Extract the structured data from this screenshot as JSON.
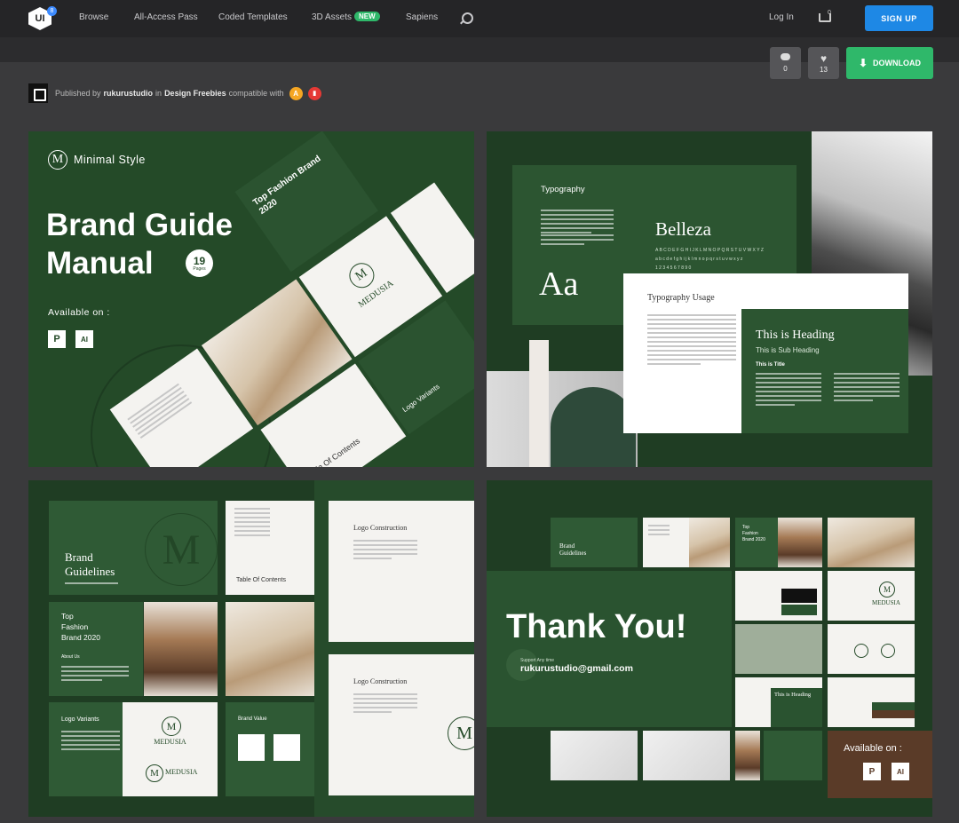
{
  "nav": {
    "logo": "UI",
    "logo_badge": "8",
    "links": [
      "Browse",
      "All-Access Pass",
      "Coded Templates",
      "3D Assets",
      "Sapiens"
    ],
    "new_badge": "NEW",
    "login": "Log In",
    "cart_count": "0",
    "signup": "SIGN UP"
  },
  "stats": {
    "comments": "0",
    "likes": "13",
    "download": "DOWNLOAD"
  },
  "publisher": {
    "prefix": "Published by",
    "author": "rukurustudio",
    "in": "in",
    "category": "Design Freebies",
    "compatible": "compatible with",
    "apps": [
      {
        "letter": "A",
        "color": "#f5a623"
      },
      {
        "letter": "▮",
        "color": "#e53935"
      }
    ]
  },
  "panel1": {
    "brand": "Minimal Style",
    "title_l1": "Brand Guide",
    "title_l2": "Manual",
    "pages_num": "19",
    "pages_label": "Pages",
    "available": "Available on :",
    "app1": "P",
    "app2": "AI",
    "card_top_fashion": "Top Fashion Brand 2020",
    "card_toc": "Table Of Contents",
    "card_logo_variants": "Logo Variants",
    "card_medusia": "MEDUSIA"
  },
  "panel2": {
    "typography": "Typography",
    "belleza": "Belleza",
    "alphabet_upper": "A B C D E F G H I J K L M N O P Q R S T U V W X Y Z",
    "alphabet_lower": "a b c d e f g h i j k l m n o p q r s t u v w x y z",
    "numbers": "1 2 3 4 5 6 7 8 9 0",
    "aa": "Aa",
    "usage": "Typography Usage",
    "heading": "This is Heading",
    "subheading": "This is Sub Heading",
    "title": "This is Title"
  },
  "panel3": {
    "brand_l1": "Brand",
    "brand_l2": "Guidelines",
    "toc": "Table Of Contents",
    "top_l1": "Top",
    "top_l2": "Fashion",
    "top_l3": "Brand 2020",
    "about": "About Us",
    "logo_variants": "Logo Variants",
    "medusia": "MEDUSIA",
    "brand_value": "Brand Value",
    "logo_construction": "Logo Construction"
  },
  "panel4": {
    "thank_you": "Thank You!",
    "support": "Support Any time",
    "email": "rukurustudio@gmail.com",
    "mini_brand_l1": "Brand",
    "mini_brand_l2": "Guidelines",
    "mini_top_l1": "Top",
    "mini_top_l2": "Fashion",
    "mini_top_l3": "Brand 2020",
    "mini_heading": "This is Heading",
    "mini_medusia": "MEDUSIA",
    "available": "Available on :",
    "app1": "P",
    "app2": "AI"
  }
}
